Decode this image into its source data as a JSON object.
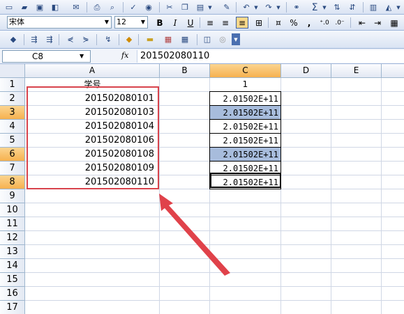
{
  "font": {
    "name": "宋体",
    "size": "12"
  },
  "format": {
    "bold": "B",
    "italic": "I",
    "underline": "U",
    "percent": "%",
    "comma": ","
  },
  "name_box": "C8",
  "formula_icon": "fx",
  "formula_content": "201502080110",
  "columns": [
    "A",
    "B",
    "C",
    "D",
    "E"
  ],
  "rows": [
    "1",
    "2",
    "3",
    "4",
    "5",
    "6",
    "7",
    "8",
    "9",
    "10",
    "11",
    "12",
    "13",
    "14",
    "15",
    "16",
    "17"
  ],
  "cells": {
    "A1": "学号",
    "C1": "1",
    "A2": "201502080101",
    "A3": "201502080103",
    "A4": "201502080104",
    "A5": "201502080106",
    "A6": "201502080108",
    "A7": "201502080109",
    "A8": "201502080110",
    "C2": "2.01502E+11",
    "C3": "2.01502E+11",
    "C4": "2.01502E+11",
    "C5": "2.01502E+11",
    "C6": "2.01502E+11",
    "C7": "2.01502E+11",
    "C8": "2.01502E+11"
  },
  "colors": {
    "highlight": "#a7bcdc",
    "annotation": "#d8434c",
    "selected_header": "#f6b14f"
  }
}
